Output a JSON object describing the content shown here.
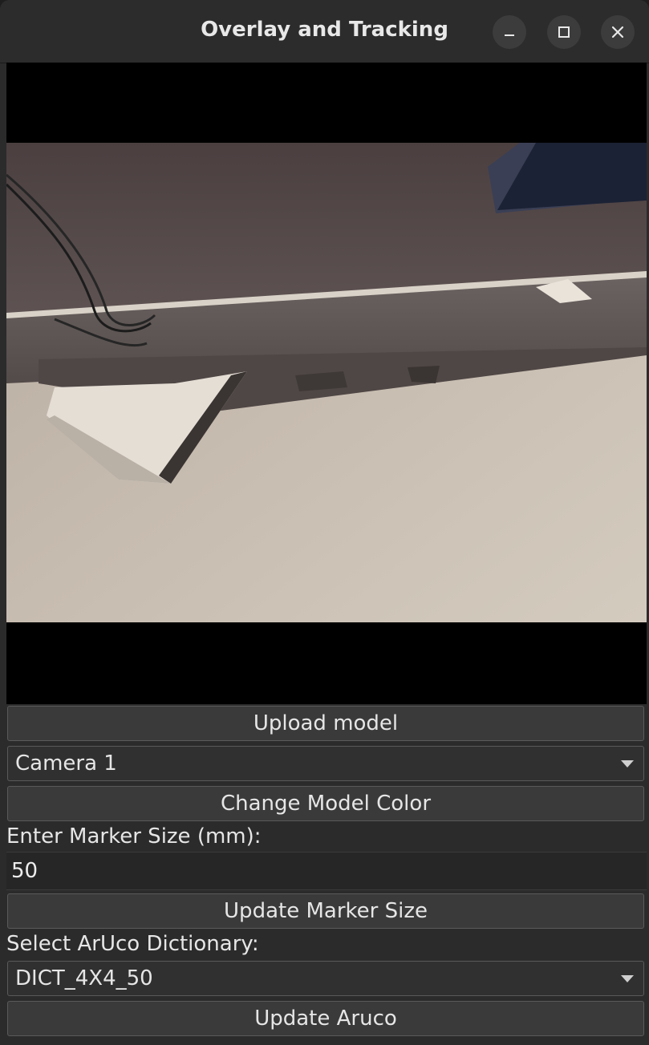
{
  "window": {
    "title": "Overlay and Tracking",
    "controls": [
      "minimize-icon",
      "maximize-icon",
      "close-icon"
    ]
  },
  "controls": {
    "upload_model_label": "Upload model",
    "camera_select": {
      "value": "Camera 1"
    },
    "change_color_label": "Change Model Color",
    "marker_size_label": "Enter Marker Size (mm):",
    "marker_size_value": "50",
    "update_marker_label": "Update Marker Size",
    "aruco_label": "Select ArUco Dictionary:",
    "aruco_select": {
      "value": "DICT_4X4_50"
    },
    "update_aruco_label": "Update Aruco"
  },
  "colors": {
    "window_bg": "#2b2b2b",
    "button_bg": "#3a3a3a",
    "text": "#e6e6e6",
    "viewport_bg": "#000000"
  }
}
